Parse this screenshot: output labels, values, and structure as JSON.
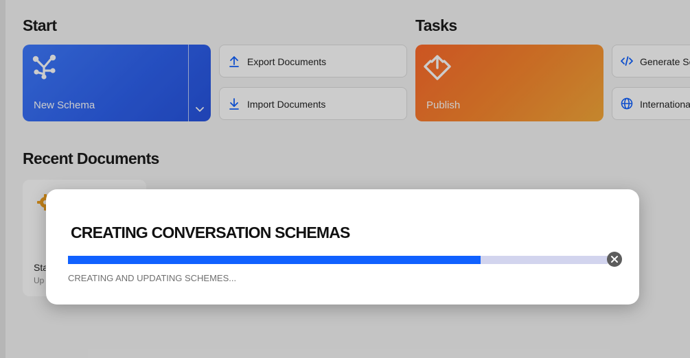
{
  "sections": {
    "start": "Start",
    "tasks": "Tasks",
    "recent": "Recent Documents"
  },
  "start_cards": {
    "new_schema_label": "New Schema",
    "export_label": "Export Documents",
    "import_label": "Import Documents"
  },
  "task_cards": {
    "publish_label": "Publish",
    "generate_label": "Generate Sc",
    "international_label": "Internationa"
  },
  "recent_documents": [
    {
      "title": "Sta",
      "subtitle": "Up"
    }
  ],
  "modal": {
    "title": "CREATING CONVERSATION SCHEMAS",
    "status": "CREATING AND UPDATING SCHEMES...",
    "progress_percent": 76.5
  },
  "colors": {
    "accent_blue": "#1061ff",
    "schema_card": "#2f63f0",
    "publish_card": "#f98a2f",
    "progress_track": "#d2d4ee"
  },
  "icons": {
    "new_schema": "schema-tree-icon",
    "dropdown": "chevron-down-icon",
    "export": "upload-arrow-icon",
    "import": "download-arrow-icon",
    "publish": "publish-diamond-icon",
    "generate": "code-icon",
    "international": "globe-icon",
    "recent_doc": "gear-icon",
    "close": "close-icon"
  }
}
